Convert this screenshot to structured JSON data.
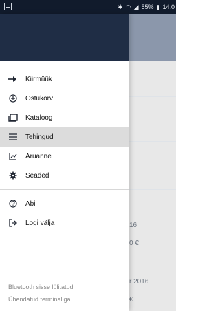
{
  "status_bar": {
    "battery_percent": "55%",
    "time": "14:0"
  },
  "drawer": {
    "menu": [
      {
        "label": "Kiirmüük",
        "icon": "quick-sale-icon"
      },
      {
        "label": "Ostukorv",
        "icon": "add-circle-icon"
      },
      {
        "label": "Kataloog",
        "icon": "catalog-icon"
      },
      {
        "label": "Tehingud",
        "icon": "list-icon"
      },
      {
        "label": "Aruanne",
        "icon": "chart-line-icon"
      },
      {
        "label": "Seaded",
        "icon": "gear-icon"
      }
    ],
    "secondary": [
      {
        "label": "Abi",
        "icon": "help-icon"
      },
      {
        "label": "Logi välja",
        "icon": "logout-icon"
      }
    ],
    "footer": [
      "Bluetooth sisse lülitatud",
      "Ühendatud terminaliga"
    ]
  },
  "background": {
    "partial_texts": [
      "16",
      "0 €",
      "r 2016",
      "€"
    ]
  }
}
